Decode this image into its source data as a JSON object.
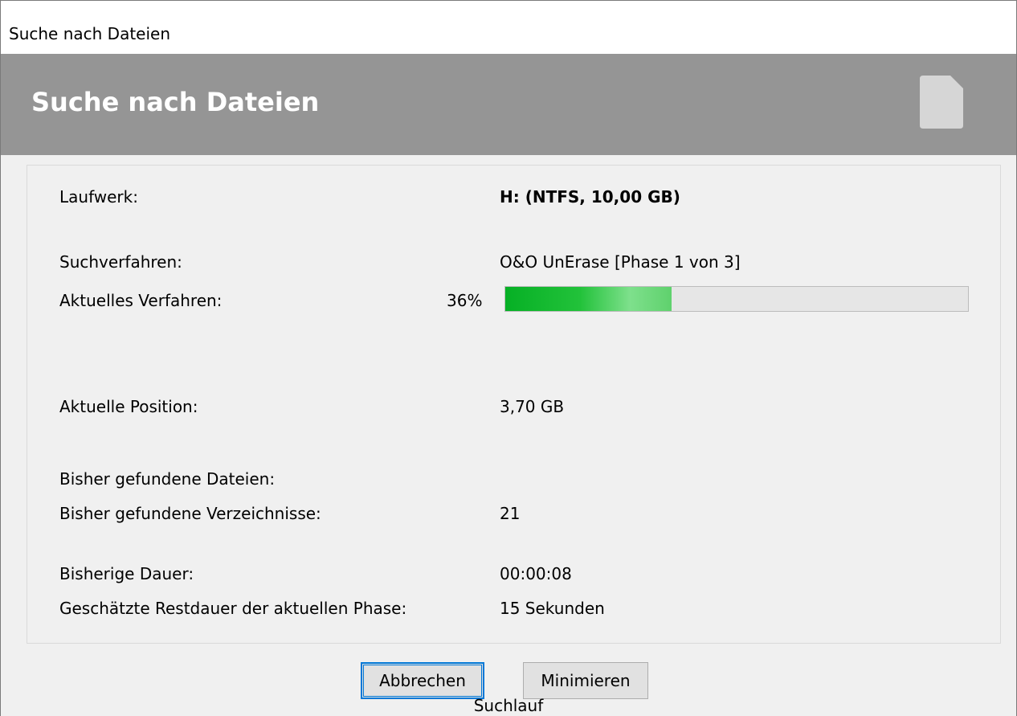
{
  "window": {
    "title": "Suche nach Dateien"
  },
  "banner": {
    "title": "Suche nach Dateien",
    "icon": "document-icon"
  },
  "details": {
    "drive": {
      "label": "Laufwerk:",
      "value": "H: (NTFS, 10,00 GB)"
    },
    "method": {
      "label": "Suchverfahren:",
      "value": "O&O UnErase [Phase 1 von 3]"
    },
    "current_method": {
      "label": "Aktuelles Verfahren:",
      "percent_text": "36%",
      "progress": 0.36
    },
    "position": {
      "label": "Aktuelle Position:",
      "value": "3,70 GB"
    },
    "files_found": {
      "label": "Bisher gefundene Dateien:",
      "value": ""
    },
    "dirs_found": {
      "label": "Bisher gefundene Verzeichnisse:",
      "value": "21"
    },
    "duration": {
      "label": "Bisherige Dauer:",
      "value": "00:00:08"
    },
    "remaining": {
      "label": "Geschätzte Restdauer der aktuellen Phase:",
      "value": "15 Sekunden"
    }
  },
  "buttons": {
    "cancel": "Abbrechen",
    "minimize": "Minimieren"
  },
  "status": "Suchlauf",
  "colors": {
    "banner": "#959595",
    "progress": "#06b025",
    "focus": "#0078d7"
  }
}
